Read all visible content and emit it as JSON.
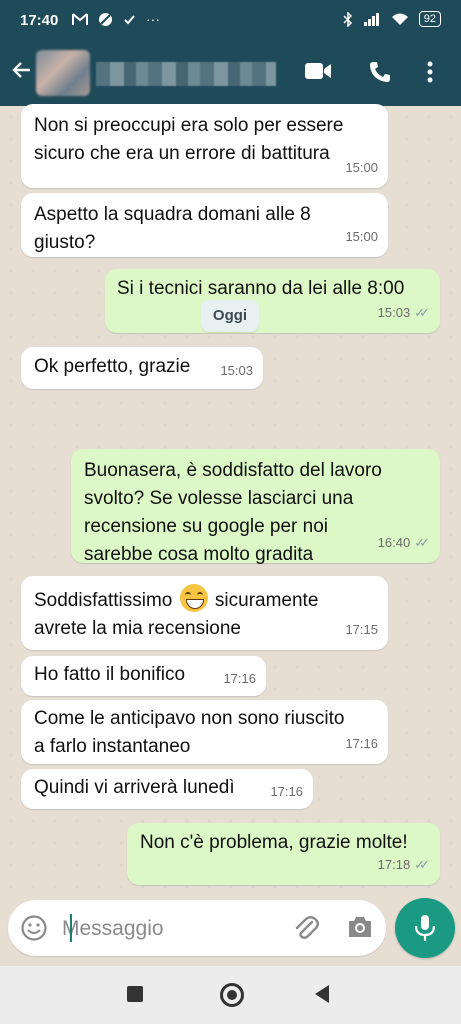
{
  "statusbar": {
    "time": "17:40",
    "notif_icons": [
      "gmail-icon",
      "ball-icon",
      "check-icon"
    ],
    "more": "···",
    "battery": "92"
  },
  "header": {
    "back_icon": "arrow-back-icon",
    "video_icon": "video-call-icon",
    "call_icon": "phone-icon",
    "menu_icon": "more-vert-icon"
  },
  "day_separator": "Oggi",
  "messages": [
    {
      "dir": "in",
      "text": "Non si preoccupi era solo per essere\nsicuro che era un errore di battitura",
      "time": "15:00"
    },
    {
      "dir": "in",
      "text": "Aspetto la squadra domani alle 8\ngiusto?",
      "time": "15:00"
    },
    {
      "dir": "out",
      "text": "Si i tecnici saranno da lei alle 8:00",
      "time": "15:03",
      "ticks": "✓✓"
    },
    {
      "dir": "in",
      "text": "Ok perfetto, grazie",
      "time": "15:03"
    },
    {
      "dir": "out",
      "text": "Buonasera, è soddisfatto del lavoro\nsvolto? Se volesse lasciarci una\nrecensione su google per noi\nsarebbe cosa molto gradita",
      "time": "16:40",
      "ticks": "✓✓"
    },
    {
      "dir": "in",
      "text_before": "Soddisfattissimo",
      "emoji": "grinning-face-emoji",
      "text_after": " sicuramente\navrete la mia recensione",
      "time": "17:15"
    },
    {
      "dir": "in",
      "text": "Ho fatto il bonifico",
      "time": "17:16"
    },
    {
      "dir": "in",
      "text": "Come le anticipavo non sono riuscito\na farlo instantaneo",
      "time": "17:16"
    },
    {
      "dir": "in",
      "text": "Quindi vi arriverà lunedì",
      "time": "17:16"
    },
    {
      "dir": "out",
      "text": "Non c'è problema, grazie molte!",
      "time": "17:18",
      "ticks": "✓✓"
    }
  ],
  "composer": {
    "placeholder": "Messaggio",
    "emoji_icon": "emoji-icon",
    "attach_icon": "paperclip-icon",
    "camera_icon": "camera-icon",
    "mic_icon": "microphone-icon"
  },
  "colors": {
    "header": "#1f4a5a",
    "incoming": "#ffffff",
    "outgoing": "#dcf8c6",
    "mic_button": "#1b9a83"
  }
}
